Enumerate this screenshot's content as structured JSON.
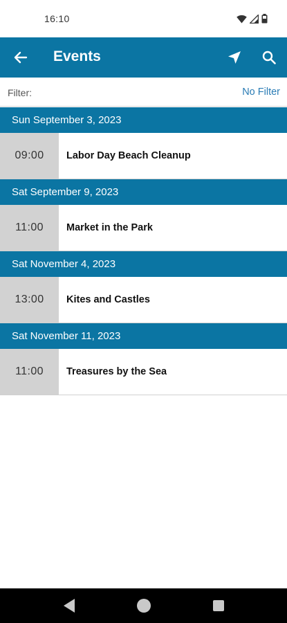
{
  "status_bar": {
    "time": "16:10",
    "icons": [
      "wifi-icon",
      "signal-icon",
      "battery-icon"
    ]
  },
  "app_bar": {
    "title": "Events",
    "actions": [
      "back-arrow-icon",
      "navigation-arrow-icon",
      "search-icon"
    ]
  },
  "filter": {
    "label": "Filter:",
    "value": "No Filter"
  },
  "events": [
    {
      "date": "Sun September 3, 2023",
      "time": "09:00",
      "title": "Labor Day Beach Cleanup"
    },
    {
      "date": "Sat September 9, 2023",
      "time": "11:00",
      "title": "Market in the Park"
    },
    {
      "date": "Sat November 4, 2023",
      "time": "13:00",
      "title": "Kites and Castles"
    },
    {
      "date": "Sat November 11, 2023",
      "time": "11:00",
      "title": "Treasures by the Sea"
    }
  ],
  "nav_bar": {
    "buttons": [
      "nav-back-icon",
      "nav-home-icon",
      "nav-recents-icon"
    ]
  },
  "colors": {
    "primary": "#0b75a3",
    "time_cell": "#d2d2d2",
    "link": "#2a7cb5"
  }
}
